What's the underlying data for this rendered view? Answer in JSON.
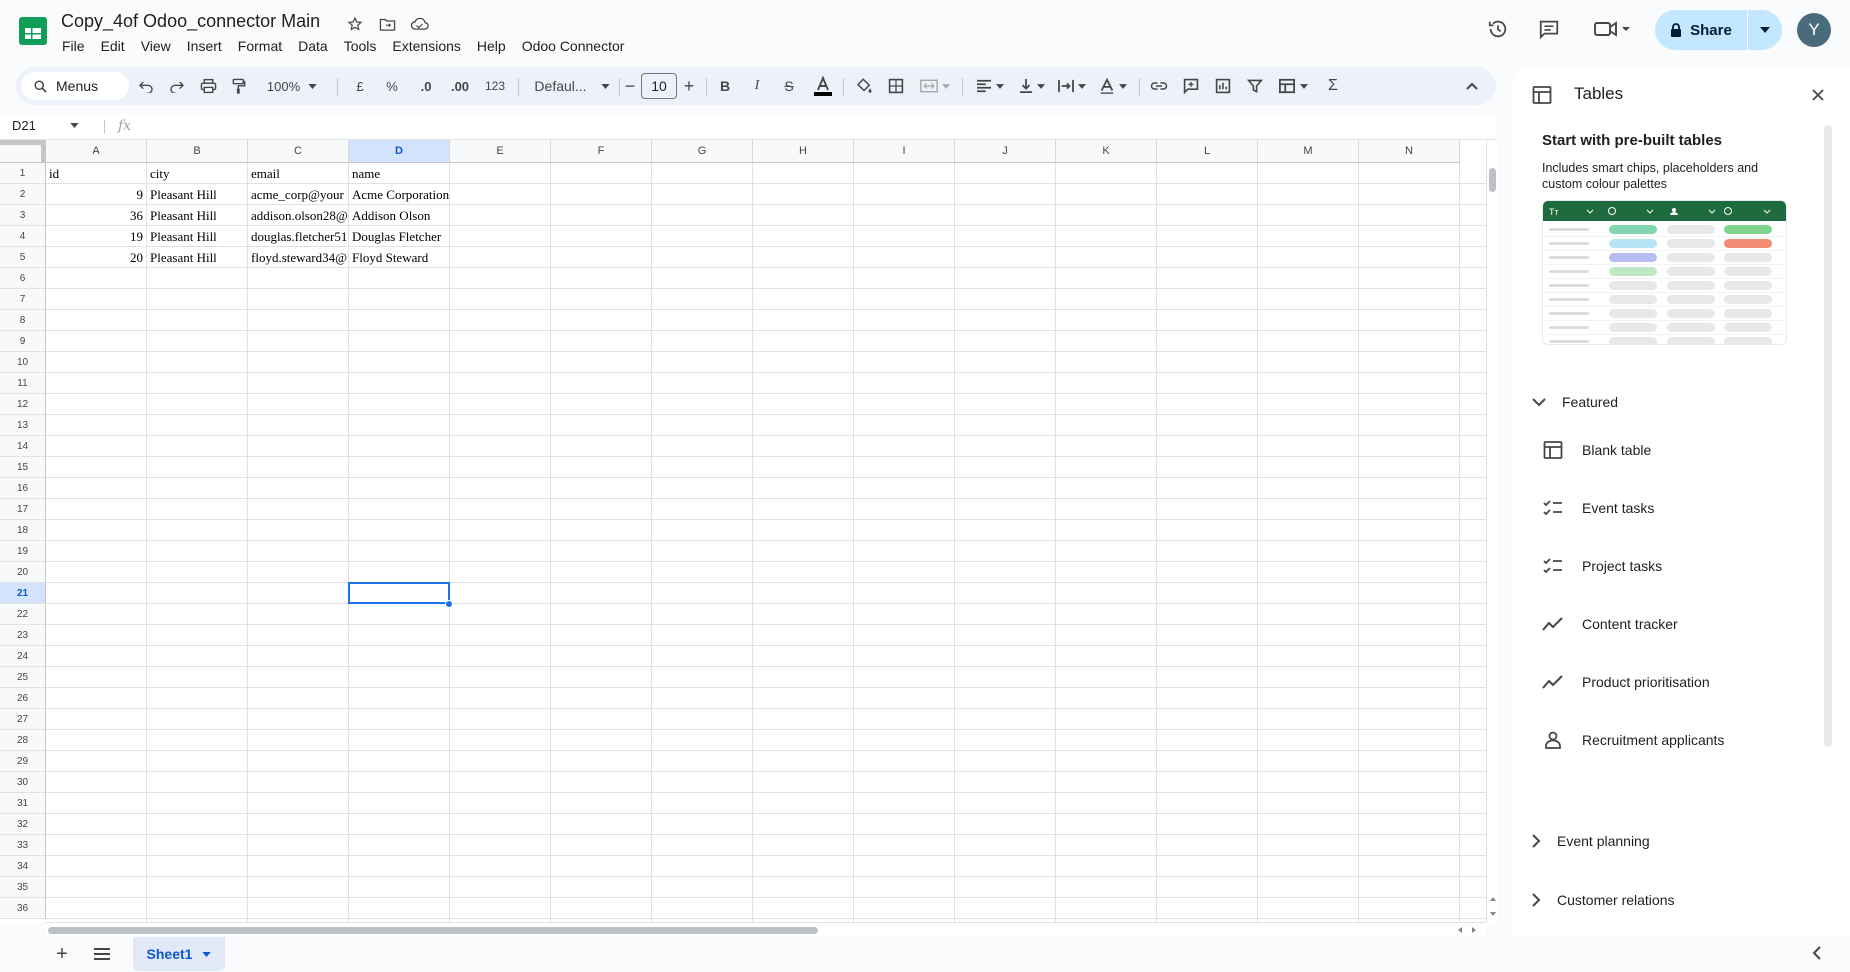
{
  "doc": {
    "title": "Copy_4of Odoo_connector Main"
  },
  "menu": [
    "File",
    "Edit",
    "View",
    "Insert",
    "Format",
    "Data",
    "Tools",
    "Extensions",
    "Help",
    "Odoo Connector"
  ],
  "header": {
    "share_label": "Share",
    "avatar_initial": "Y"
  },
  "toolbar": {
    "menus_label": "Menus",
    "zoom": "100%",
    "currency": "£",
    "percent": "%",
    "dec_decrease": ".0",
    "dec_increase": ".00",
    "number_format": "123",
    "font": "Defaul...",
    "font_size": "10"
  },
  "formula_bar": {
    "cell_ref": "D21",
    "fx": "fx",
    "content": ""
  },
  "grid": {
    "columns": [
      "A",
      "B",
      "C",
      "D",
      "E",
      "F",
      "G",
      "H",
      "I",
      "J",
      "K",
      "L",
      "M",
      "N"
    ],
    "selected_column": "D",
    "selected_row": 21,
    "visible_rows": 36,
    "rows": [
      {
        "cells": [
          {
            "col": "A",
            "v": "id"
          },
          {
            "col": "B",
            "v": "city"
          },
          {
            "col": "C",
            "v": "email"
          },
          {
            "col": "D",
            "v": "name"
          }
        ]
      },
      {
        "cells": [
          {
            "col": "A",
            "v": "9",
            "num": true
          },
          {
            "col": "B",
            "v": "Pleasant Hill"
          },
          {
            "col": "C",
            "v": "acme_corp@your"
          },
          {
            "col": "D",
            "v": "Acme Corporation",
            "ovf": true
          }
        ]
      },
      {
        "cells": [
          {
            "col": "A",
            "v": "36",
            "num": true
          },
          {
            "col": "B",
            "v": "Pleasant Hill"
          },
          {
            "col": "C",
            "v": "addison.olson28@"
          },
          {
            "col": "D",
            "v": "Addison Olson"
          }
        ]
      },
      {
        "cells": [
          {
            "col": "A",
            "v": "19",
            "num": true
          },
          {
            "col": "B",
            "v": "Pleasant Hill"
          },
          {
            "col": "C",
            "v": "douglas.fletcher51"
          },
          {
            "col": "D",
            "v": "Douglas Fletcher"
          }
        ]
      },
      {
        "cells": [
          {
            "col": "A",
            "v": "20",
            "num": true
          },
          {
            "col": "B",
            "v": "Pleasant Hill"
          },
          {
            "col": "C",
            "v": "floyd.steward34@"
          },
          {
            "col": "D",
            "v": "Floyd Steward"
          }
        ]
      }
    ]
  },
  "sheets": [
    {
      "name": "Sheet1"
    }
  ],
  "panel": {
    "title": "Tables",
    "prebuilt_title": "Start with pre-built tables",
    "prebuilt_desc": "Includes smart chips, placeholders and custom colour palettes",
    "featured_label": "Featured",
    "items": [
      {
        "label": "Blank table",
        "icon": "table-icon"
      },
      {
        "label": "Event tasks",
        "icon": "checklist-icon"
      },
      {
        "label": "Project tasks",
        "icon": "checklist-icon"
      },
      {
        "label": "Content tracker",
        "icon": "trend-icon"
      },
      {
        "label": "Product prioritisation",
        "icon": "trend-icon"
      },
      {
        "label": "Recruitment applicants",
        "icon": "person-icon"
      }
    ],
    "sections": [
      {
        "label": "Event planning"
      },
      {
        "label": "Customer relations"
      }
    ]
  },
  "colors": {
    "accent": "#1a73e8",
    "share_bg": "#c2e7ff",
    "toolbar_bg": "#edf2fa",
    "sheets_green": "#0f9d58"
  }
}
